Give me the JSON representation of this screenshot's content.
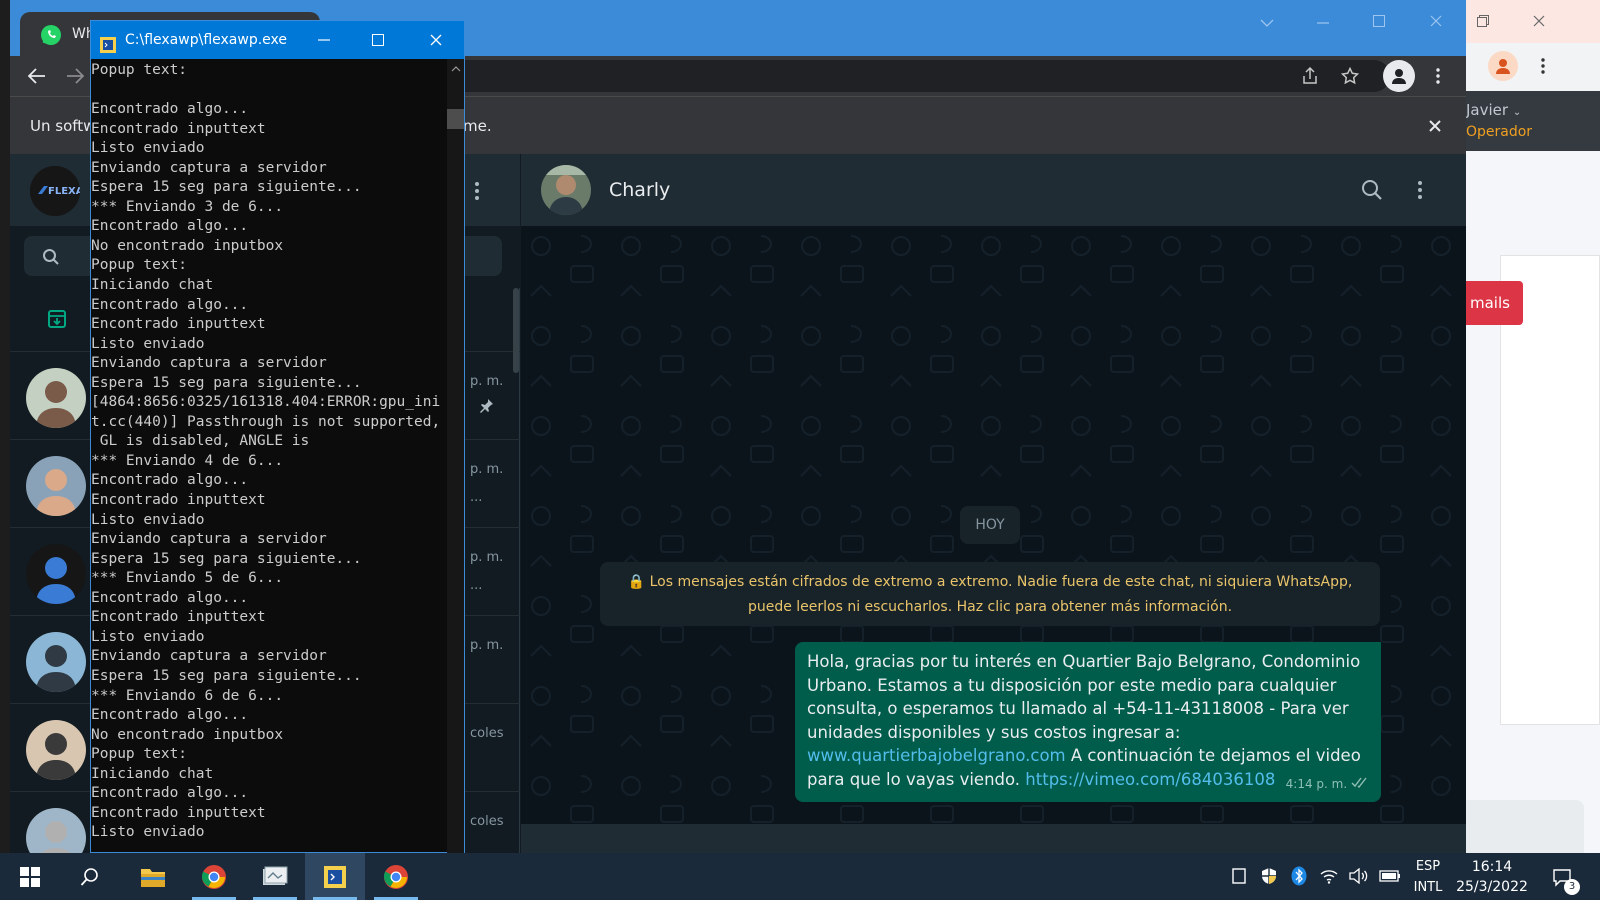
{
  "background_browser": {
    "user_name": "Javier",
    "user_role": "Operador",
    "button_partial": "mails",
    "role_color": "#f0a020",
    "button_color": "#dc3545"
  },
  "chrome": {
    "tab_title": "Wha",
    "infobar_text_left": "Un softw",
    "infobar_text_right": "me."
  },
  "console": {
    "title": "C:\\flexawp\\flexawp.exe",
    "lines": "Popup text:\n\nEncontrado algo...\nEncontrado inputtext\nListo enviado\nEnviando captura a servidor\nEspera 15 seg para siguiente...\n*** Enviando 3 de 6...\nEncontrado algo...\nNo encontrado inputbox\nPopup text:\nIniciando chat\nEncontrado algo...\nEncontrado inputtext\nListo enviado\nEnviando captura a servidor\nEspera 15 seg para siguiente...\n[4864:8656:0325/161318.404:ERROR:gpu_ini\nt.cc(440)] Passthrough is not supported,\n GL is disabled, ANGLE is\n*** Enviando 4 de 6...\nEncontrado algo...\nEncontrado inputtext\nListo enviado\nEnviando captura a servidor\nEspera 15 seg para siguiente...\n*** Enviando 5 de 6...\nEncontrado algo...\nEncontrado inputtext\nListo enviado\nEnviando captura a servidor\nEspera 15 seg para siguiente...\n*** Enviando 6 de 6...\nEncontrado algo...\nNo encontrado inputbox\nPopup text:\nIniciando chat\nEncontrado algo...\nEncontrado inputtext\nListo enviado"
  },
  "whatsapp": {
    "contact_name": "Charly",
    "chat_list": [
      {
        "time": "p. m."
      },
      {
        "time": "p. m.",
        "preview": "..."
      },
      {
        "time": "p. m.",
        "preview": "..."
      },
      {
        "time": "p. m."
      },
      {
        "time": "coles"
      },
      {
        "time": "coles"
      }
    ],
    "date_chip": "HOY",
    "encryption_notice": "Los mensajes están cifrados de extremo a extremo. Nadie fuera de este chat, ni siquiera WhatsApp, puede leerlos ni escucharlos. Haz clic para obtener más información.",
    "message": {
      "text_part1": "Hola, gracias por tu interés en Quartier Bajo Belgrano, Condominio Urbano. Estamos a tu disposición por este medio para cualquier consulta, o esperamos tu llamado al +54-11-43118008  - Para ver unidades disponibles y sus costos ingresar a:",
      "link1": "www.quartierbajobelgrano.com",
      "text_part2": " A continuación te dejamos el video para que lo vayas viendo. ",
      "link2": "https://vimeo.com/684036108",
      "time": "4:14 p. m."
    },
    "colors": {
      "outgoing_bubble": "#005c4b",
      "header": "#202c33",
      "background": "#0b141a",
      "link": "#53bdeb"
    }
  },
  "taskbar": {
    "language_top": "ESP",
    "language_bottom": "INTL",
    "time": "16:14",
    "date": "25/3/2022",
    "notifications_count": "3"
  }
}
